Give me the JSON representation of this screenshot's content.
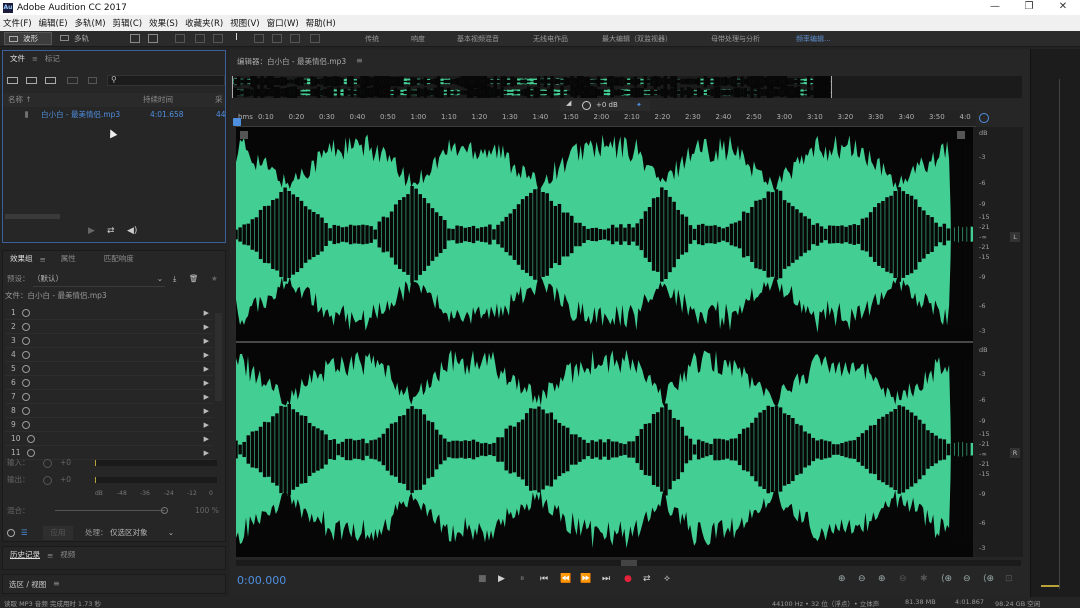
{
  "window": {
    "title": "Adobe Audition CC 2017",
    "logo": "Au",
    "minimize": "—",
    "restore": "❐",
    "close": "✕"
  },
  "menu": [
    "文件(F)",
    "编辑(E)",
    "多轨(M)",
    "剪辑(C)",
    "效果(S)",
    "收藏夹(R)",
    "视图(V)",
    "窗口(W)",
    "帮助(H)"
  ],
  "toolbar": {
    "waveform_label": "波形",
    "multitrack_label": "多轨",
    "workspaces": [
      "传统",
      "响度",
      "基本视频混音",
      "无线电作品",
      "最大编辑（双监视器）",
      "母带处理与分析",
      "频率编辑..."
    ]
  },
  "files_panel": {
    "tabs": [
      "文件",
      "标记"
    ],
    "columns": [
      "名称 ↑",
      "持续时间",
      "采"
    ],
    "file": {
      "name": "白小白 - 最美情侣.mp3",
      "duration": "4:01.658",
      "rate": "44"
    }
  },
  "effects_panel": {
    "tabs": [
      "效果组",
      "属性",
      "匹配响度"
    ],
    "preset_label": "预设：",
    "preset_value": "（默认）",
    "file_label": "文件：白小白 - 最美情侣.mp3",
    "slots": [
      "1",
      "2",
      "3",
      "4",
      "5",
      "6",
      "7",
      "8",
      "9",
      "10",
      "11"
    ],
    "input_label": "输入：",
    "output_label": "输出：",
    "input_value": "+0",
    "output_value": "+0",
    "meter_ticks": [
      "dB",
      "-48",
      "-36",
      "-24",
      "-12",
      "0"
    ],
    "mix_label": "混合：",
    "mix_value": "100 %",
    "process_label": "处理：",
    "process_value": "仅选区对象",
    "apply_label": "应用"
  },
  "history_panel": {
    "tabs": [
      "历史记录",
      "视频"
    ]
  },
  "selection_panel": {
    "label": "选区 / 视图"
  },
  "editor": {
    "title": "编辑器：白小白 - 最美情侣.mp3",
    "gain_value": "+0 dB",
    "ruler_ticks": [
      "hms",
      "0:10",
      "0:20",
      "0:30",
      "0:40",
      "0:50",
      "1:00",
      "1:10",
      "1:20",
      "1:30",
      "1:40",
      "1:50",
      "2:00",
      "2:10",
      "2:20",
      "2:30",
      "2:40",
      "2:50",
      "3:00",
      "3:10",
      "3:20",
      "3:30",
      "3:40",
      "3:50",
      "4:0"
    ],
    "db_top": [
      "dB",
      "-3",
      "-6",
      "-9",
      "-15",
      "-21",
      "-∞",
      "-21",
      "-15",
      "-9",
      "-6",
      "-3"
    ],
    "db_bottom": [
      "dB",
      "-3",
      "-6",
      "-9",
      "-15",
      "-21",
      "-∞",
      "-21",
      "-15",
      "-9",
      "-6",
      "-3"
    ],
    "channel_top": "L",
    "channel_bottom": "R",
    "time_display": "0:00.000",
    "wave_color": "#43cf94"
  },
  "status": {
    "left": "读取 MP3 音频 完成用时 1.73 秒",
    "sample_info": "44100 Hz • 32 位（浮点）• 立体声",
    "size": "81.38 MB",
    "duration": "4:01.867",
    "free": "98.24 GB 空闲"
  }
}
